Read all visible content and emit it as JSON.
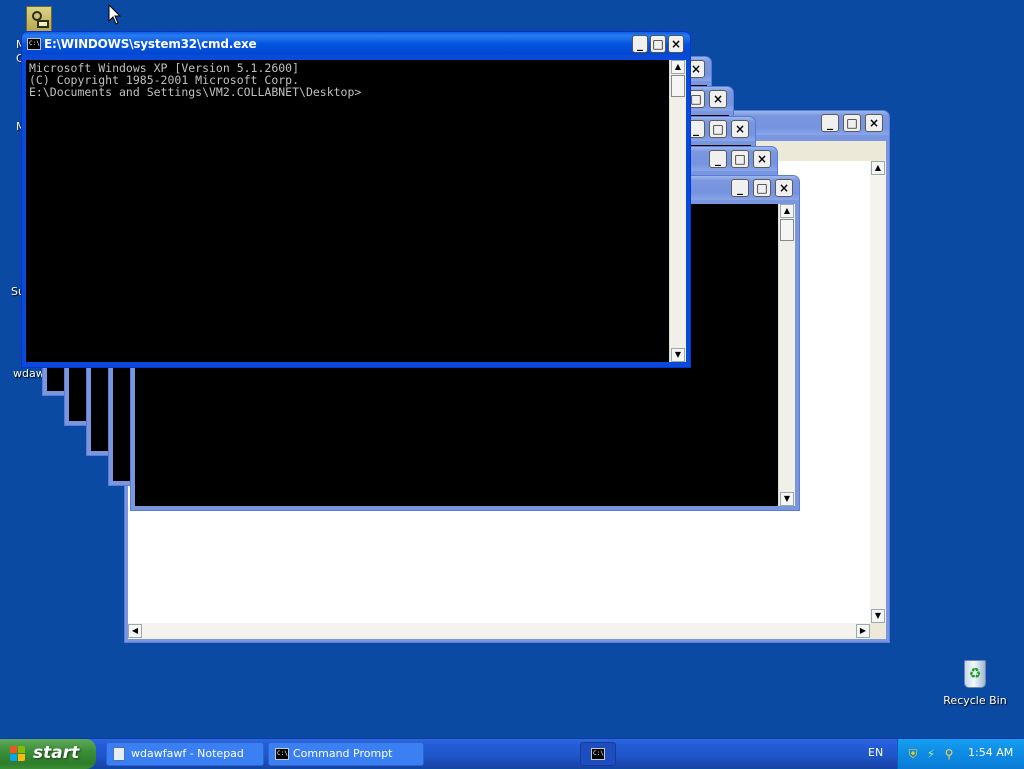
{
  "desktop": {
    "partial_labels": [
      {
        "text": "M"
      },
      {
        "text": "C"
      },
      {
        "text": "M"
      },
      {
        "text": "Su"
      },
      {
        "text": "wdawf"
      }
    ],
    "recycle_bin_label": "Recycle Bin"
  },
  "windows": {
    "main_cmd": {
      "title": "E:\\WINDOWS\\system32\\cmd.exe",
      "lines": [
        "Microsoft Windows XP [Version 5.1.2600]",
        "(C) Copyright 1985-2001 Microsoft Corp.",
        "",
        "E:\\Documents and Settings\\VM2.COLLABNET\\Desktop>"
      ]
    },
    "notepad": {
      "title": ""
    }
  },
  "titlebar_buttons": {
    "minimize": "_",
    "maximize": "□",
    "close": "×"
  },
  "taskbar": {
    "start_label": "start",
    "tasks": [
      {
        "label": "wdawfawf - Notepad"
      },
      {
        "label": "Command Prompt"
      },
      {
        "label": ""
      }
    ],
    "language": "EN",
    "clock": "1:54 AM"
  },
  "colors": {
    "desktop": "#0b4aa3",
    "taskbar": "#245edb",
    "start_green": "#3c8f39",
    "tray": "#0f8ee7",
    "console_bg": "#000000",
    "console_text": "#c0c0c0"
  },
  "icons": {
    "start": "windows-flag-icon",
    "notepad_task": "notepad-icon",
    "cmd_task": "command-prompt-icon",
    "tray": [
      "shield-icon",
      "network-icon",
      "search-icon"
    ]
  }
}
